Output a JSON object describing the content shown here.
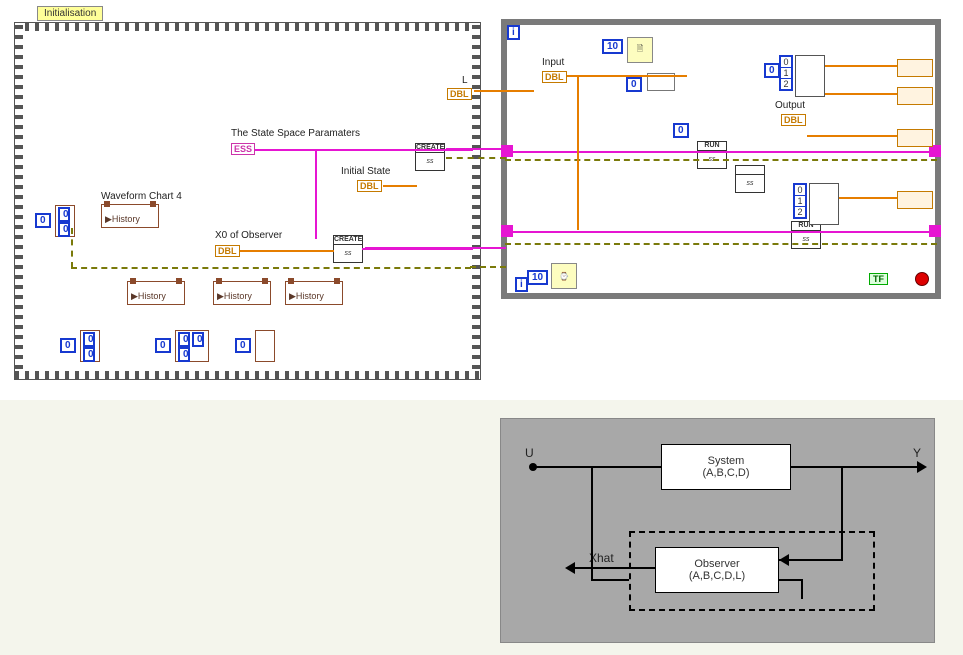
{
  "init_frame": {
    "title": "Initialisation",
    "labels": {
      "state_space": "The State Space Paramaters",
      "initial_state": "Initial State",
      "x0_observer": "X0 of Observer",
      "wvf_chart4": "Waveform Chart 4",
      "L": "L"
    },
    "dbl_tags": {
      "ss": "ESS",
      "is": "DBL",
      "x0": "DBL",
      "L": "DBL"
    },
    "subvi": {
      "create": "CREATE",
      "ss": "ss"
    },
    "history": "History",
    "zeros": {
      "c1": "0",
      "c2": "0",
      "c3": "0",
      "c4": "0",
      "c5": "0",
      "c6": "0",
      "c7": "0",
      "c8": "0",
      "c9": "0",
      "c10": "0",
      "c11": "0"
    }
  },
  "loop": {
    "labels": {
      "input": "Input",
      "output": "Output"
    },
    "dbl_in": "DBL",
    "dbl_out": "DBL",
    "const10a": "10",
    "const10b": "10",
    "idx_i": "i",
    "idx_block1": [
      "0",
      "1",
      "2"
    ],
    "idx_block2": [
      "0",
      "1",
      "2"
    ],
    "subvi": {
      "run": "RUN",
      "ss": "ss"
    },
    "tf_label": "TF",
    "zeros": {
      "z1": "0",
      "z2": "0",
      "z3": "0"
    }
  },
  "bd": {
    "U": "U",
    "Y": "Y",
    "Xhat": "Xhat",
    "system_title": "System",
    "system_params": "(A,B,C,D)",
    "obs_title": "Observer",
    "obs_params": "(A,B,C,D,L)"
  }
}
